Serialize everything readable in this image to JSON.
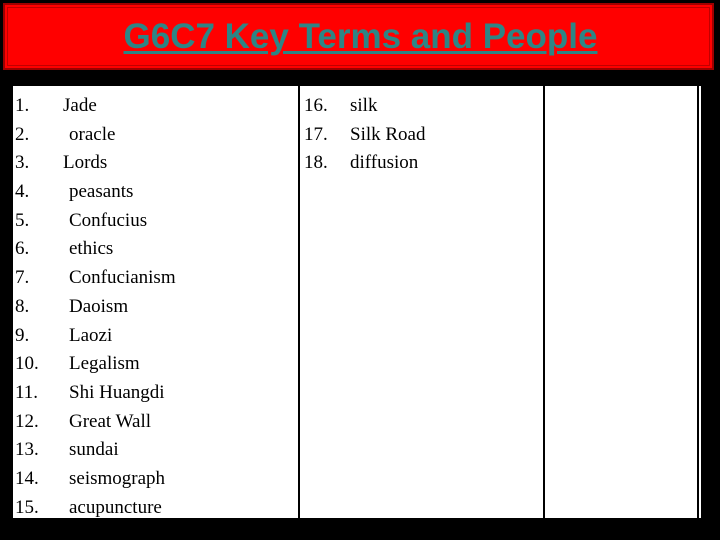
{
  "slide": {
    "background_color": "#000000",
    "title": {
      "text": "G6C7 Key Terms and People",
      "text_color": "#2D8585",
      "banner_color": "#FF0000",
      "banner_border_color": "#9E0000",
      "underlined": "true"
    },
    "table": {
      "background_color": "#FFFFFF",
      "border_color": "#000000",
      "columns": [
        {
          "name": "column-1",
          "items": [
            {
              "num": "1.",
              "label": "Jade",
              "indent": 0
            },
            {
              "num": "2.",
              "label": "oracle",
              "indent": 1
            },
            {
              "num": "3.",
              "label": "Lords",
              "indent": 0
            },
            {
              "num": "4.",
              "label": "peasants",
              "indent": 1
            },
            {
              "num": "5.",
              "label": "Confucius",
              "indent": 1
            },
            {
              "num": "6.",
              "label": "ethics",
              "indent": 1
            },
            {
              "num": "7.",
              "label": "Confucianism",
              "indent": 1
            },
            {
              "num": "8.",
              "label": "Daoism",
              "indent": 1
            },
            {
              "num": "9.",
              "label": "Laozi",
              "indent": 1
            },
            {
              "num": "10.",
              "label": "Legalism",
              "indent": 1
            },
            {
              "num": "11.",
              "label": "Shi Huangdi",
              "indent": 1
            },
            {
              "num": "12.",
              "label": "Great Wall",
              "indent": 1
            },
            {
              "num": "13.",
              "label": "sundai",
              "indent": 1
            },
            {
              "num": "14.",
              "label": "seismograph",
              "indent": 1
            },
            {
              "num": "15.",
              "label": "acupuncture",
              "indent": 1
            }
          ]
        },
        {
          "name": "column-2",
          "items": [
            {
              "num": "16.",
              "label": "silk",
              "indent": 0
            },
            {
              "num": "17.",
              "label": "Silk Road",
              "indent": 0
            },
            {
              "num": "18.",
              "label": "diffusion",
              "indent": 0
            }
          ]
        },
        {
          "name": "column-3",
          "items": []
        }
      ]
    }
  }
}
